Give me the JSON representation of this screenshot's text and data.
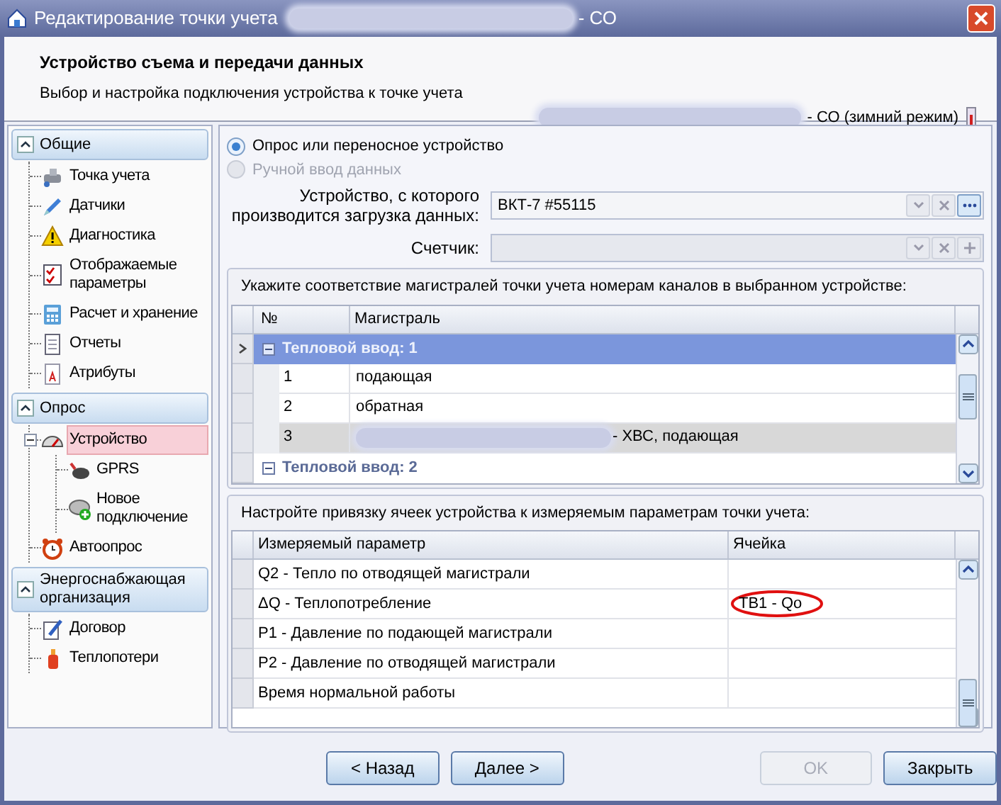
{
  "window": {
    "title": "Редактирование точки учета",
    "title_blurred": true,
    "title_suffix": "- СО"
  },
  "header": {
    "title": "Устройство съема и передачи данных",
    "subtitle": "Выбор и настройка подключения устройства к точке учета",
    "location_blurred": true,
    "location_suffix": "- СО (зимний режим)"
  },
  "sidebar": [
    {
      "label": "Общие",
      "expanded": true,
      "items": [
        {
          "label": "Точка учета",
          "selected": false
        },
        {
          "label": "Датчики",
          "selected": false
        },
        {
          "label": "Диагностика",
          "selected": false
        },
        {
          "label": "Отображаемые параметры",
          "selected": false
        },
        {
          "label": "Расчет и хранение",
          "selected": false
        },
        {
          "label": "Отчеты",
          "selected": false
        },
        {
          "label": "Атрибуты",
          "selected": false
        }
      ]
    },
    {
      "label": "Опрос",
      "expanded": true,
      "items": [
        {
          "label": "Устройство",
          "selected": true,
          "expanded": true,
          "children": [
            {
              "label": "GPRS",
              "selected": false
            },
            {
              "label": "Новое подключение",
              "selected": false
            }
          ]
        },
        {
          "label": "Автоопрос",
          "selected": false
        }
      ]
    },
    {
      "label": "Энергоснабжающая организация",
      "expanded": true,
      "items": [
        {
          "label": "Договор",
          "selected": false
        },
        {
          "label": "Теплопотери",
          "selected": false
        }
      ]
    }
  ],
  "source_options": [
    {
      "label": "Опрос или переносное устройство",
      "selected": true,
      "disabled": false
    },
    {
      "label": "Ручной ввод данных",
      "selected": false,
      "disabled": true
    }
  ],
  "device_field": {
    "label": "Устройство, с которого производится загрузка данных:",
    "value": "ВКТ-7 #55115",
    "disabled": false
  },
  "counter_field": {
    "label": "Счетчик:",
    "disabled": true
  },
  "mains_table": {
    "caption": "Укажите соответствие магистралей точки учета номерам каналов в выбранном устройстве:",
    "columns": [
      "№",
      "Магистраль"
    ],
    "groups": [
      {
        "label": "Тепловой ввод: 1",
        "selected": true,
        "expanded": true,
        "rows": [
          {
            "number": "1",
            "name": "подающая",
            "blurred": false,
            "selected": false
          },
          {
            "number": "2",
            "name": "обратная",
            "blurred": false,
            "selected": false
          },
          {
            "number": "3",
            "name": "- ХВС, подающая",
            "blurred": true,
            "selected": true
          }
        ]
      },
      {
        "label": "Тепловой ввод: 2",
        "selected": false,
        "expanded": true
      }
    ]
  },
  "params_table": {
    "caption": "Настройте привязку ячеек устройства к измеряемым параметрам точки учета:",
    "columns": [
      "Измеряемый параметр",
      "Ячейка"
    ],
    "rows": [
      {
        "parameter": "Q2 - Тепло по отводящей магистрали",
        "circled": false
      },
      {
        "parameter": "ΔQ - Теплопотребление",
        "cell": "ТВ1 - Qo",
        "circled": true
      },
      {
        "parameter": "P1 - Давление по подающей магистрали",
        "circled": false
      },
      {
        "parameter": "P2 - Давление по отводящей магистрали",
        "circled": false
      },
      {
        "parameter": "Время нормальной работы",
        "circled": false
      }
    ]
  },
  "buttons": [
    {
      "label": "< Назад",
      "disabled": false
    },
    {
      "label": "Далее >",
      "disabled": false
    },
    {
      "label": "OK",
      "disabled": true
    },
    {
      "label": "Закрыть",
      "disabled": false
    }
  ]
}
